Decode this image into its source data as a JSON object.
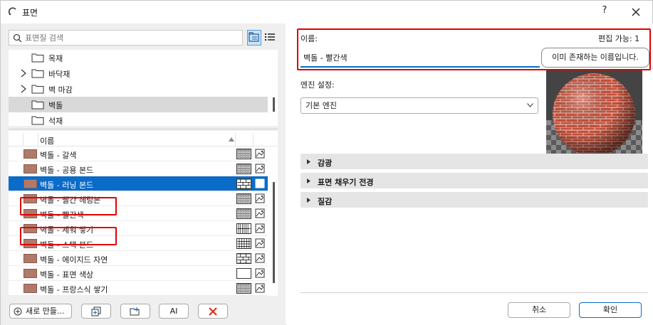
{
  "window": {
    "title": "표면",
    "help_label": "?"
  },
  "search": {
    "placeholder": "표면질 검색"
  },
  "folders": [
    {
      "label": "목재",
      "expandable": false,
      "selected": false
    },
    {
      "label": "바닥재",
      "expandable": true,
      "selected": false
    },
    {
      "label": "벽 마감",
      "expandable": true,
      "selected": false
    },
    {
      "label": "벽돌",
      "expandable": false,
      "selected": true
    },
    {
      "label": "석재",
      "expandable": false,
      "selected": false
    }
  ],
  "list": {
    "column_name": "이름",
    "rows": [
      {
        "name": "벽돌 - 갈색",
        "pattern": "brick-small"
      },
      {
        "name": "벽돌 - 공용 본드",
        "pattern": "brick-small"
      },
      {
        "name": "벽돌 - 러닝 본드",
        "pattern": "brick-large",
        "selected": true
      },
      {
        "name": "벽돌 - 빨간 헤링본",
        "pattern": "brick-small"
      },
      {
        "name": "벽돌 - 빨간색",
        "pattern": "brick-small"
      },
      {
        "name": "벽돌 - 세워 쌓기",
        "pattern": "vertical"
      },
      {
        "name": "벽돌 - 스택 본드",
        "pattern": "grid"
      },
      {
        "name": "벽돌 - 에이지드 자연",
        "pattern": "brick-large"
      },
      {
        "name": "벽돌 - 표면 색상",
        "pattern": "empty"
      },
      {
        "name": "벽돌 - 프랑스식 쌓기",
        "pattern": "brick-small"
      }
    ]
  },
  "bottom_buttons": {
    "new": "새로 만들...",
    "rename_glyph": "AI"
  },
  "right": {
    "name_label": "이름:",
    "editable": "편집 가능: 1",
    "name_value": "벽돌 - 빨간색",
    "tooltip": "이미 존재하는 이름입니다.",
    "engine_label": "엔진 설정:",
    "engine_value": "기본 엔진",
    "sections": [
      "감광",
      "표면 채우기 전경",
      "질감"
    ],
    "cancel": "취소",
    "ok": "확인"
  },
  "colors": {
    "accent": "#0a6bc9",
    "highlight": "#e00000",
    "swatch": "#b07a6b"
  }
}
